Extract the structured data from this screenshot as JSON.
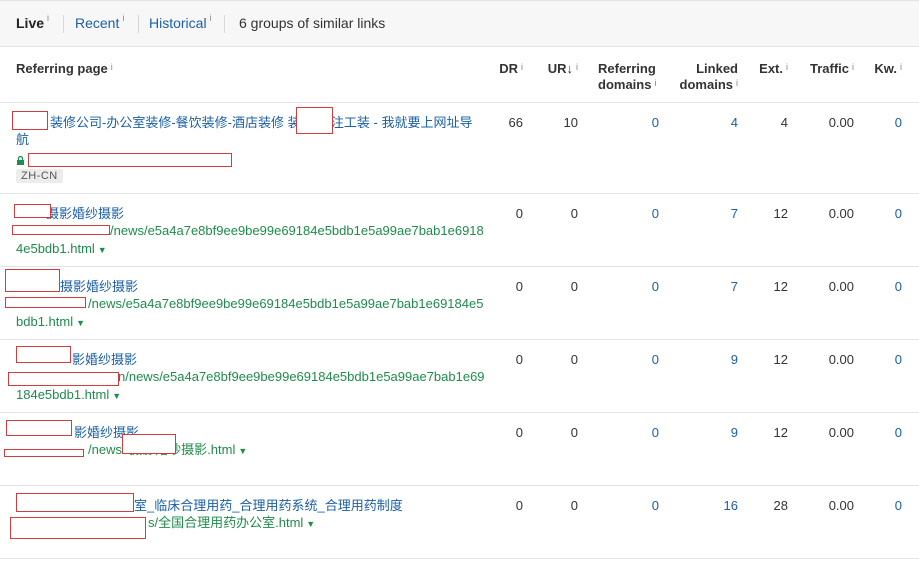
{
  "tabs": {
    "live": "Live",
    "recent": "Recent",
    "historical": "Historical",
    "info": "i",
    "groups": "6 groups of similar links"
  },
  "columns": {
    "referring_page": "Referring page",
    "dr": "DR",
    "ur": "UR",
    "ur_sort": "↓",
    "referring_domains_1": "Referring",
    "referring_domains_2": "domains",
    "linked_domains_1": "Linked",
    "linked_domains_2": "domains",
    "ext": "Ext.",
    "traffic": "Traffic",
    "kw": "Kw.",
    "info": "i"
  },
  "rows": [
    {
      "title": "装修公司-办公室装修-餐饮装修-酒店装修 装饰-专注工装 - 我就要上网址导航",
      "url": "",
      "lang": "ZH-CN",
      "dr": "66",
      "ur": "10",
      "ref": "0",
      "linked": "4",
      "ext": "4",
      "traffic": "0.00",
      "kw": "0"
    },
    {
      "title": "摄影婚纱摄影",
      "url": "/news/e5a4a7e8bf9ee9be99e69184e5bdb1e5a99ae7bab1e69184e5bdb1.html",
      "dr": "0",
      "ur": "0",
      "ref": "0",
      "linked": "7",
      "ext": "12",
      "traffic": "0.00",
      "kw": "0"
    },
    {
      "title": "摄影婚纱摄影",
      "url": "/news/e5a4a7e8bf9ee9be99e69184e5bdb1e5a99ae7bab1e69184e5bdb1.html",
      "dr": "0",
      "ur": "0",
      "ref": "0",
      "linked": "7",
      "ext": "12",
      "traffic": "0.00",
      "kw": "0"
    },
    {
      "title": "影婚纱摄影",
      "url": "n/news/e5a4a7e8bf9ee9be99e69184e5bdb1e5a99ae7bab1e69184e5bdb1.html",
      "dr": "0",
      "ur": "0",
      "ref": "0",
      "linked": "9",
      "ext": "12",
      "traffic": "0.00",
      "kw": "0"
    },
    {
      "title": "影婚纱摄影",
      "url": "/news/ 摄影婚纱摄影.html",
      "dr": "0",
      "ur": "0",
      "ref": "0",
      "linked": "9",
      "ext": "12",
      "traffic": "0.00",
      "kw": "0"
    },
    {
      "title": "室_临床合理用药_合理用药系统_合理用药制度",
      "url": "s/全国合理用药办公室.html",
      "dr": "0",
      "ur": "0",
      "ref": "0",
      "linked": "16",
      "ext": "28",
      "traffic": "0.00",
      "kw": "0"
    }
  ],
  "colors": {
    "link_blue": "#1b5fa6",
    "url_green": "#1e8c4a",
    "redaction_red": "#d23c3c"
  }
}
